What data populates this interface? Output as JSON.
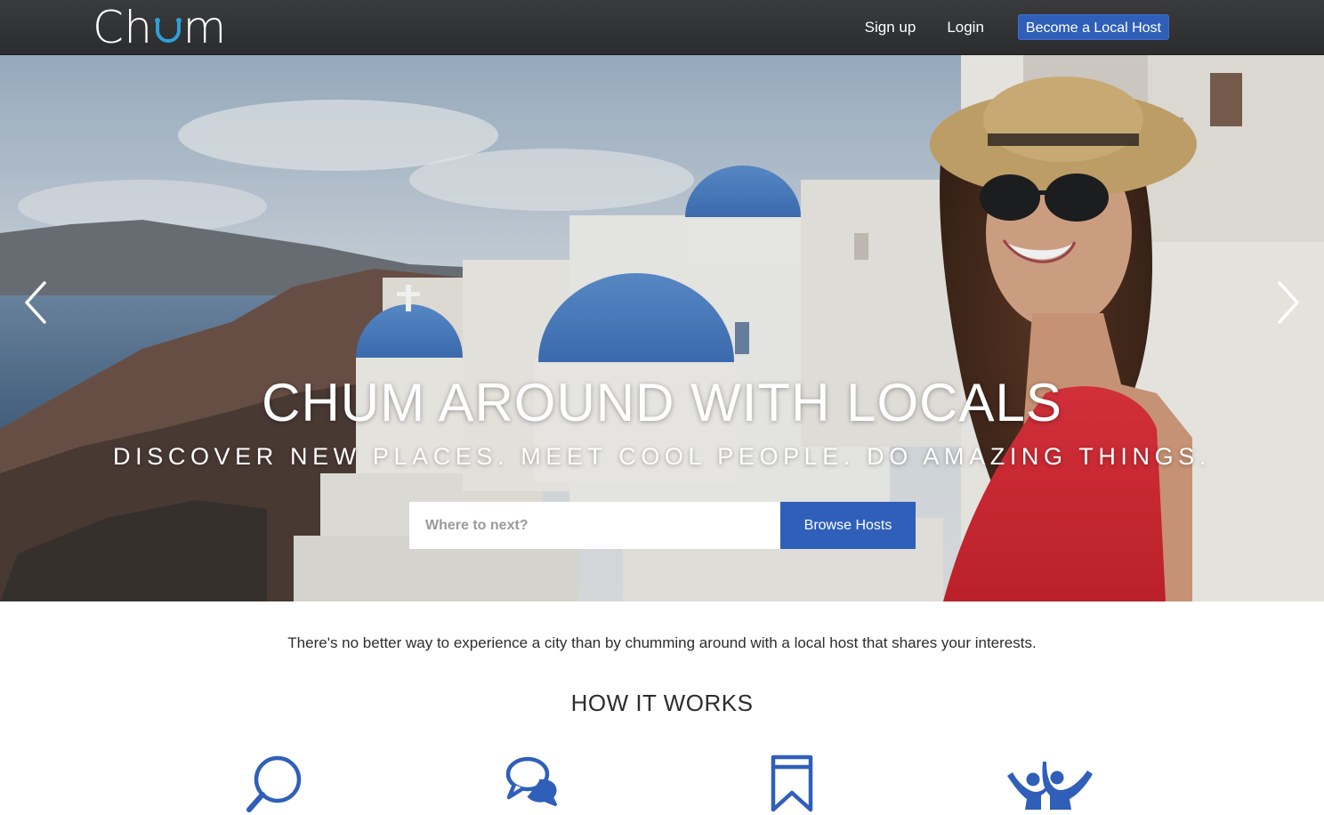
{
  "brand": {
    "name_prefix": "Ch",
    "name_suffix": "m",
    "accent_color": "#2f9fd8"
  },
  "nav": {
    "signup_label": "Sign up",
    "login_label": "Login",
    "host_label": "Become a Local Host"
  },
  "hero": {
    "title": "CHUM AROUND WITH LOCALS",
    "subtitle": "DISCOVER NEW PLACES. MEET COOL PEOPLE. DO AMAZING THINGS.",
    "search_placeholder": "Where to next?",
    "browse_label": "Browse Hosts",
    "prev_icon": "chevron-left-icon",
    "next_icon": "chevron-right-icon"
  },
  "content": {
    "tagline": "There's no better way to experience a city than by chumming around with a local host that shares your interests.",
    "how_it_works_title": "HOW IT WORKS",
    "steps": [
      {
        "icon": "search-icon"
      },
      {
        "icon": "chat-bubbles-icon"
      },
      {
        "icon": "bookmark-icon"
      },
      {
        "icon": "people-cheering-icon"
      }
    ]
  },
  "colors": {
    "primary": "#2f5fb9",
    "navbar": "#2e2f31",
    "icon_blue": "#2f5fb9"
  }
}
